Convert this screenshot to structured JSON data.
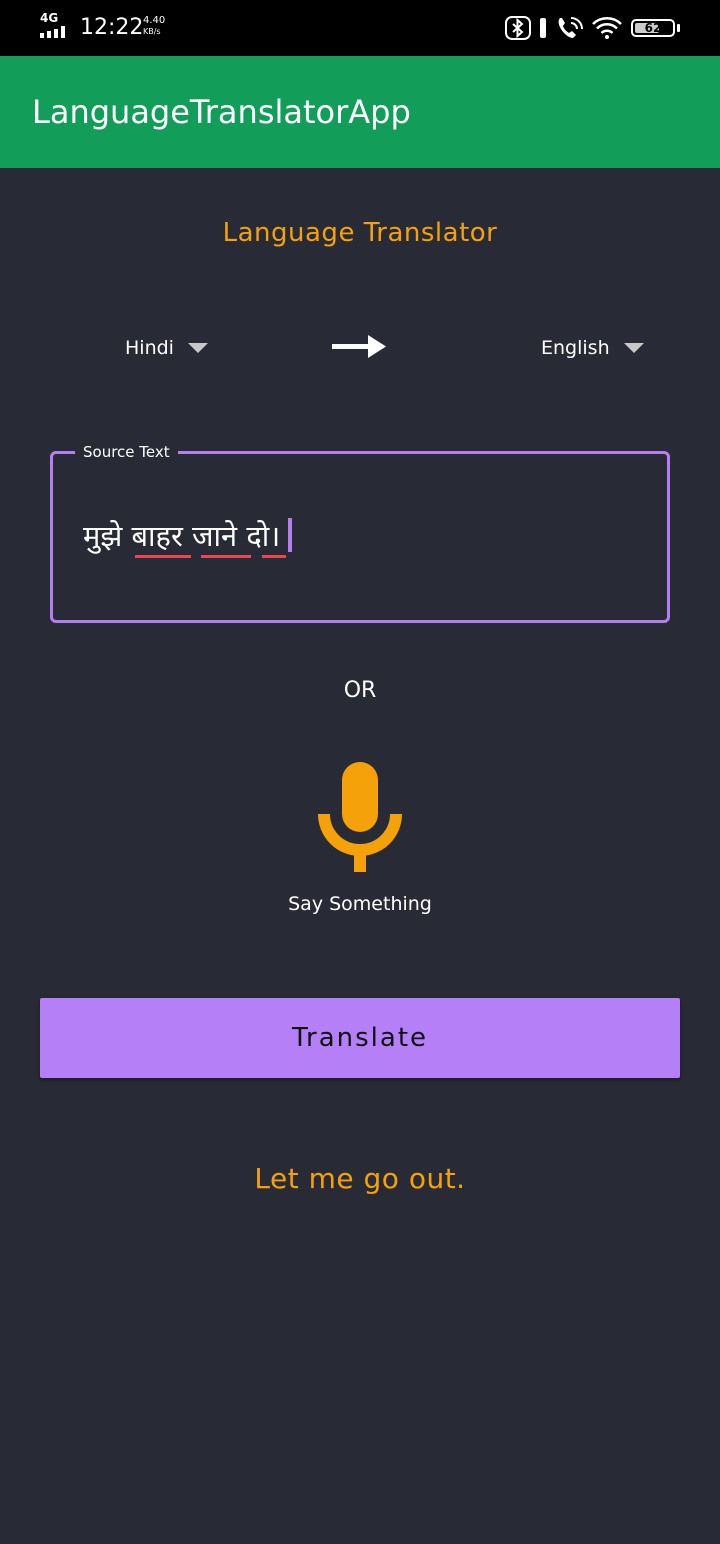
{
  "status_bar": {
    "network": "4G",
    "time": "12:22",
    "speed_value": "4.40",
    "speed_unit": "KB/s",
    "battery": "62",
    "icons": [
      "bluetooth-icon",
      "vibrate-icon",
      "wifi-calling-icon",
      "wifi-icon",
      "battery-icon"
    ]
  },
  "app_bar": {
    "title": "LanguageTranslatorApp",
    "color": "#129e58"
  },
  "main": {
    "heading": "Language Translator",
    "source_language": "Hindi",
    "target_language": "English",
    "source_field": {
      "label": "Source Text",
      "value": "मुझे बाहर जाने दो।"
    },
    "or_label": "OR",
    "mic_label": "Say Something",
    "translate_button": "Translate",
    "result": "Let me go out."
  },
  "colors": {
    "background": "#282b35",
    "accent_orange": "#f5a10a",
    "accent_purple": "#b57ff8",
    "app_bar": "#129e58"
  }
}
